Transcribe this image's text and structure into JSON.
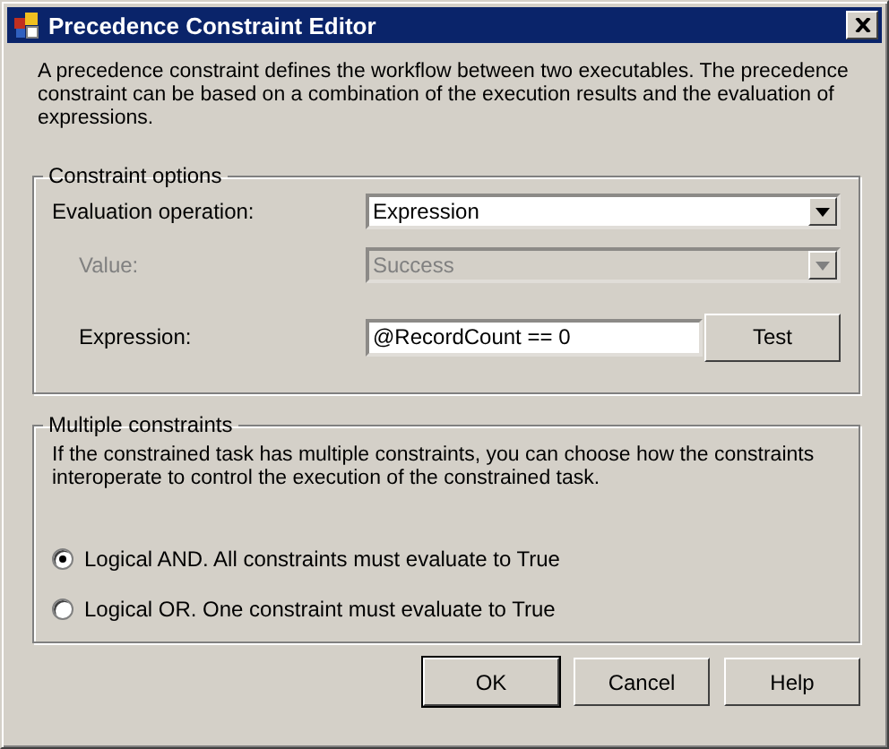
{
  "window": {
    "title": "Precedence Constraint Editor"
  },
  "description": "A precedence constraint defines the workflow between two executables. The precedence constraint can be based on a combination of the execution results and the evaluation of expressions.",
  "constraint_options": {
    "title": "Constraint options",
    "fields": [
      {
        "kind": "select",
        "label": "Evaluation operation:",
        "value": "Expression",
        "disabled": false
      },
      {
        "kind": "select",
        "label": "Value:",
        "value": "Success",
        "disabled": true
      },
      {
        "kind": "input",
        "label": "Expression:",
        "value": "@RecordCount == 0",
        "button": "Test"
      }
    ]
  },
  "multiple_constraints": {
    "title": "Multiple constraints",
    "description": "If the constrained task has multiple constraints, you can choose how the constraints interoperate to control the execution of the constrained task.",
    "options": [
      {
        "label": "Logical AND. All constraints must evaluate to True",
        "selected": true
      },
      {
        "label": "Logical OR. One constraint must evaluate to True",
        "selected": false
      }
    ]
  },
  "buttons": [
    {
      "label": "OK",
      "default": true
    },
    {
      "label": "Cancel",
      "default": false
    },
    {
      "label": "Help",
      "default": false
    }
  ]
}
